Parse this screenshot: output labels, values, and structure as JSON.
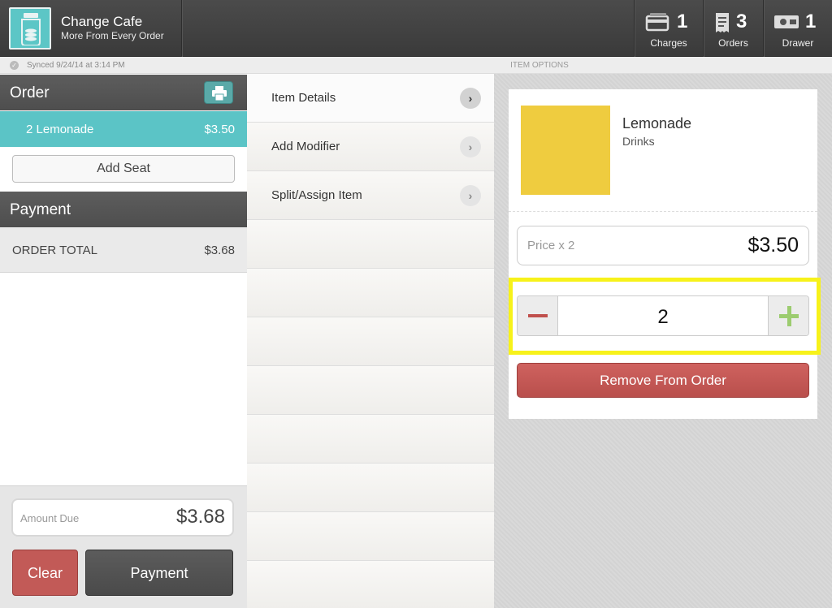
{
  "app": {
    "name": "Change Cafe",
    "tagline": "More From Every Order",
    "logo_icon": "mason-jar-icon",
    "accent": "#5bc4c6"
  },
  "stats": [
    {
      "icon": "card-icon",
      "count": "1",
      "label": "Charges"
    },
    {
      "icon": "receipt-icon",
      "count": "3",
      "label": "Orders"
    },
    {
      "icon": "cash-drawer-icon",
      "count": "1",
      "label": "Drawer"
    }
  ],
  "sync": {
    "text": "Synced 9/24/14 at 3:14 PM"
  },
  "order": {
    "header": "Order",
    "print_icon": "printer-icon",
    "lines": [
      {
        "qty_name": "2 Lemonade",
        "price": "$3.50"
      }
    ],
    "add_seat": "Add Seat"
  },
  "payment": {
    "header": "Payment",
    "total_label": "ORDER TOTAL",
    "total_value": "$3.68"
  },
  "footer": {
    "amount_due_label": "Amount Due",
    "amount_due_value": "$3.68",
    "clear_label": "Clear",
    "payment_label": "Payment"
  },
  "item_options": {
    "header": "ITEM OPTIONS",
    "menu": [
      "Item Details",
      "Add Modifier",
      "Split/Assign Item"
    ]
  },
  "item": {
    "name": "Lemonade",
    "category": "Drinks",
    "swatch_color": "#efcc3f",
    "price_label": "Price x 2",
    "price_value": "$3.50",
    "quantity": "2",
    "remove_label": "Remove From Order"
  }
}
